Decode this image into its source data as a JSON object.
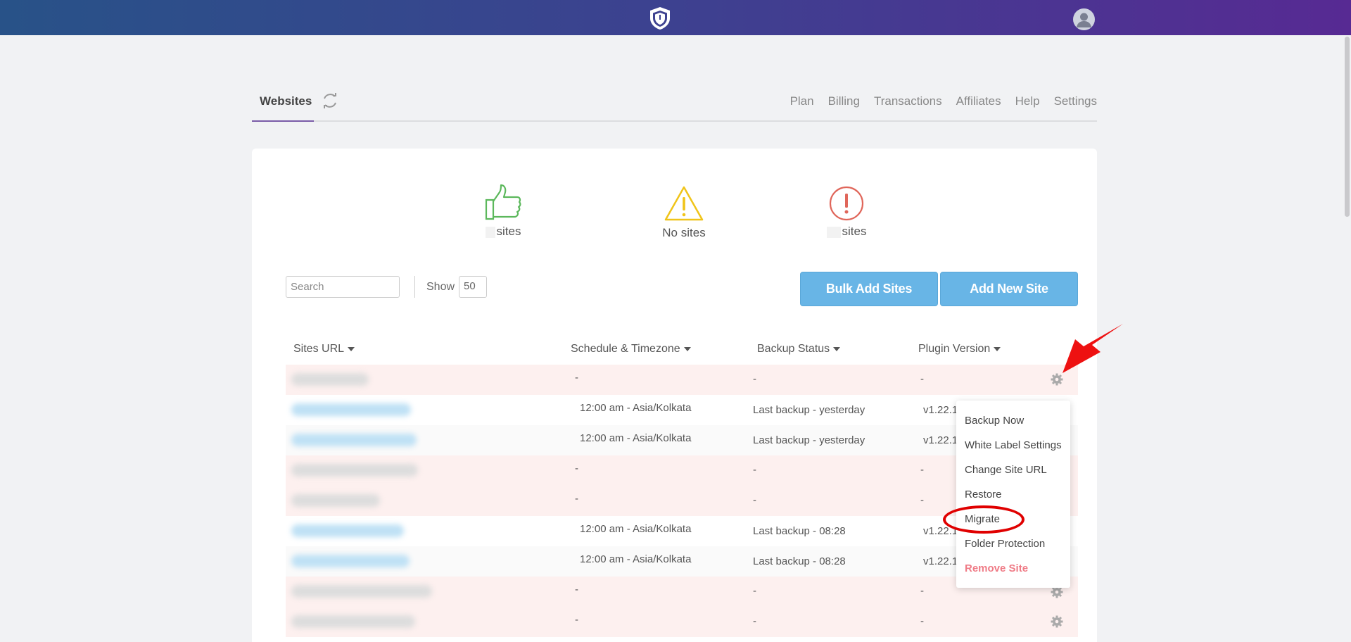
{
  "header": {
    "logo_icon": "shield-icon",
    "avatar_icon": "user-avatar-icon"
  },
  "tabs": {
    "active": "Websites",
    "refresh_icon": "refresh-icon",
    "nav": [
      "Plan",
      "Billing",
      "Transactions",
      "Affiliates",
      "Help",
      "Settings"
    ]
  },
  "stats": [
    {
      "icon": "thumbs-up-icon",
      "label": "sites",
      "color": "#5cb85c"
    },
    {
      "icon": "warning-icon",
      "label": "No sites",
      "color": "#f0c419"
    },
    {
      "icon": "error-icon",
      "label": "sites",
      "color": "#e0665a"
    }
  ],
  "toolbar": {
    "search_placeholder": "Search",
    "show_label": "Show",
    "show_value": "50",
    "bulk_add_label": "Bulk Add Sites",
    "add_new_label": "Add New Site"
  },
  "table": {
    "headers": [
      "Sites URL",
      "Schedule & Timezone",
      "Backup Status",
      "Plugin Version"
    ],
    "rows": [
      {
        "schedule": "-",
        "status": "-",
        "version": "-",
        "state": "pink"
      },
      {
        "schedule": "12:00 am - Asia/Kolkata",
        "status": "Last backup - yesterday",
        "version": "v1.22.1",
        "state": "white"
      },
      {
        "schedule": "12:00 am - Asia/Kolkata",
        "status": "Last backup - yesterday",
        "version": "v1.22.1",
        "state": "grey"
      },
      {
        "schedule": "-",
        "status": "-",
        "version": "-",
        "state": "pink"
      },
      {
        "schedule": "-",
        "status": "-",
        "version": "-",
        "state": "pink"
      },
      {
        "schedule": "12:00 am - Asia/Kolkata",
        "status": "Last backup - 08:28",
        "version": "v1.22.1",
        "state": "white"
      },
      {
        "schedule": "12:00 am - Asia/Kolkata",
        "status": "Last backup - 08:28",
        "version": "v1.22.1",
        "state": "grey"
      },
      {
        "schedule": "-",
        "status": "-",
        "version": "-",
        "state": "pink"
      },
      {
        "schedule": "-",
        "status": "-",
        "version": "-",
        "state": "pink"
      }
    ]
  },
  "menu": {
    "items": [
      "Backup Now",
      "White Label Settings",
      "Change Site URL",
      "Restore",
      "Migrate",
      "Folder Protection",
      "Remove Site"
    ]
  },
  "colors": {
    "accent": "#68b5e6",
    "danger": "#ef7b86",
    "tab_underline": "#7a5ba8"
  }
}
